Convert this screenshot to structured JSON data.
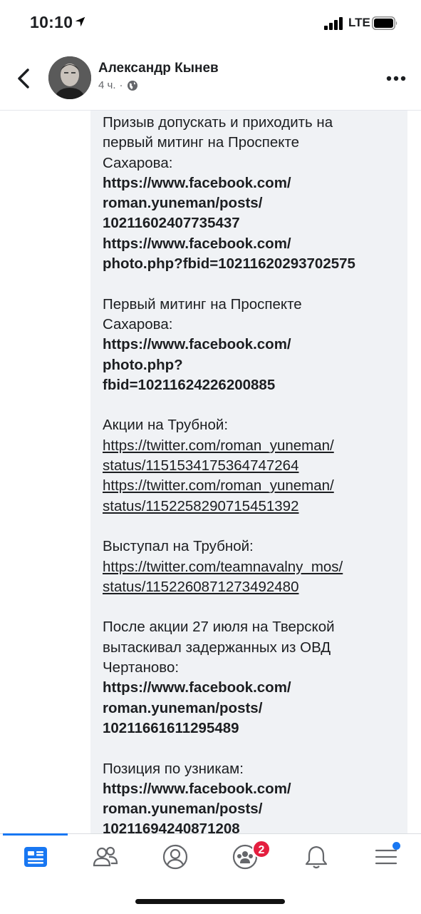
{
  "status_bar": {
    "time": "10:10",
    "network": "LTE"
  },
  "header": {
    "author": "Александр Кынев",
    "time_ago": "4 ч.",
    "separator": "·"
  },
  "post": {
    "sections": [
      [
        {
          "text": "Призыв допускать и приходить на",
          "style": "normal"
        },
        {
          "text": "первый митинг на Проспекте",
          "style": "normal"
        },
        {
          "text": "Сахарова:",
          "style": "normal"
        },
        {
          "text": "https://www.facebook.com/",
          "style": "bold"
        },
        {
          "text": "roman.yuneman/posts/",
          "style": "bold"
        },
        {
          "text": "10211602407735437",
          "style": "bold"
        },
        {
          "text": "https://www.facebook.com/",
          "style": "bold"
        },
        {
          "text": "photo.php?fbid=10211620293702575",
          "style": "bold"
        }
      ],
      [
        {
          "text": "Первый митинг на Проспекте",
          "style": "normal"
        },
        {
          "text": "Сахарова:",
          "style": "normal"
        },
        {
          "text": "https://www.facebook.com/",
          "style": "bold"
        },
        {
          "text": "photo.php?",
          "style": "bold"
        },
        {
          "text": "fbid=10211624226200885",
          "style": "bold"
        }
      ],
      [
        {
          "text": "Акции на Трубной:",
          "style": "normal"
        },
        {
          "text": "https://twitter.com/roman_yuneman/",
          "style": "link"
        },
        {
          "text": "status/1151534175364747264",
          "style": "link"
        },
        {
          "text": "https://twitter.com/roman_yuneman/",
          "style": "link"
        },
        {
          "text": "status/1152258290715451392",
          "style": "link"
        }
      ],
      [
        {
          "text": "Выступал на Трубной:",
          "style": "normal"
        },
        {
          "text": "https://twitter.com/teamnavalny_mos/",
          "style": "link"
        },
        {
          "text": "status/1152260871273492480",
          "style": "link"
        }
      ],
      [
        {
          "text": "После акции 27 июля на Тверской",
          "style": "normal"
        },
        {
          "text": "вытаскивал задержанных из ОВД",
          "style": "normal"
        },
        {
          "text": "Чертаново:",
          "style": "normal"
        },
        {
          "text": "https://www.facebook.com/",
          "style": "bold"
        },
        {
          "text": "roman.yuneman/posts/",
          "style": "bold"
        },
        {
          "text": "10211661611295489",
          "style": "bold"
        }
      ],
      [
        {
          "text": "Позиция по узникам:",
          "style": "normal"
        },
        {
          "text": "https://www.facebook.com/",
          "style": "bold"
        },
        {
          "text": "roman.yuneman/posts/",
          "style": "bold"
        },
        {
          "text": "10211694240871208",
          "style": "bold"
        }
      ]
    ]
  },
  "bottom_nav": {
    "items": [
      {
        "name": "nav-news-feed",
        "icon": "news-feed-icon",
        "active": true
      },
      {
        "name": "nav-friends",
        "icon": "friends-icon",
        "active": false
      },
      {
        "name": "nav-profile",
        "icon": "profile-icon",
        "active": false
      },
      {
        "name": "nav-groups",
        "icon": "groups-icon",
        "active": false
      },
      {
        "name": "nav-notifications",
        "icon": "bell-icon",
        "active": false
      },
      {
        "name": "nav-menu",
        "icon": "menu-icon",
        "active": false
      }
    ],
    "groups_badge": "2",
    "menu_has_dot": true
  },
  "colors": {
    "accent": "#1877f2",
    "badge": "#e41e3f",
    "bubble": "#f0f2f5",
    "text": "#1c1e21",
    "secondary": "#65676b"
  }
}
